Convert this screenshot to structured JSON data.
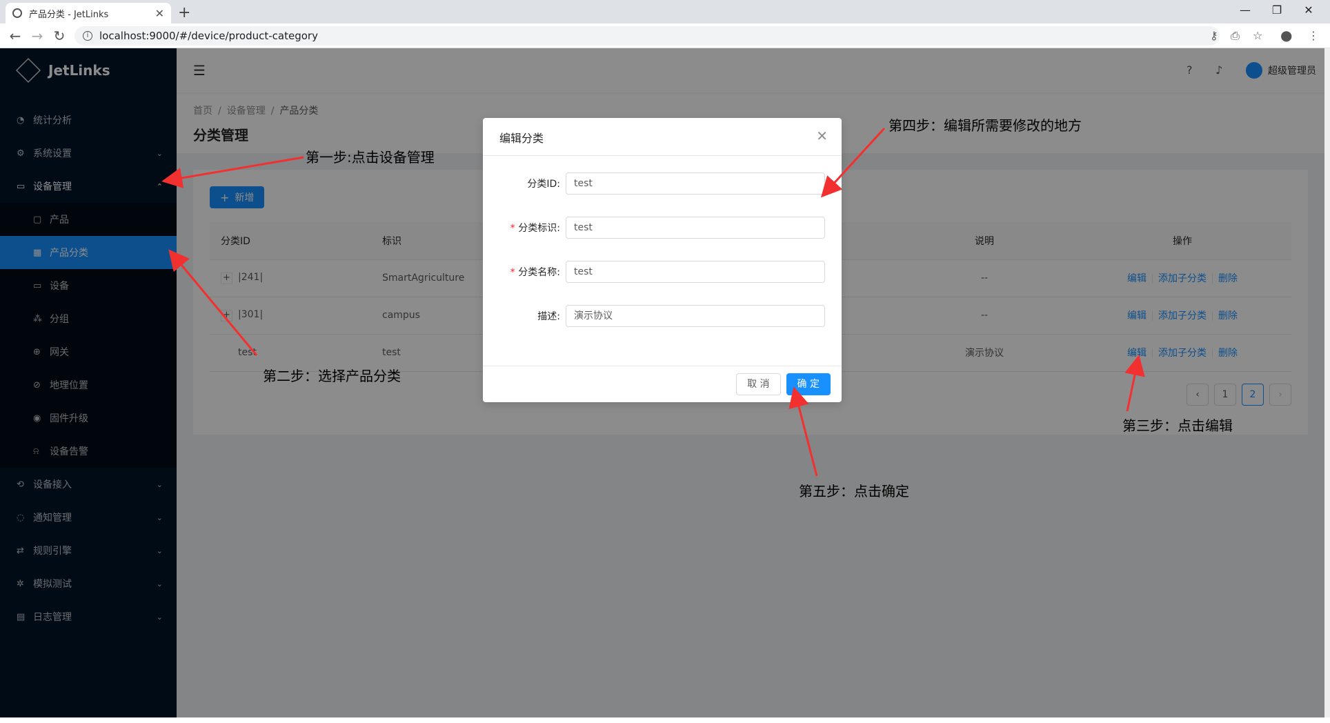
{
  "browser": {
    "tab_title": "产品分类 - JetLinks",
    "tab_close": "✕",
    "new_tab": "+",
    "url": "localhost:9000/#/device/product-category",
    "win_min": "—",
    "win_restore": "❐",
    "win_close": "✕"
  },
  "app": {
    "logo": "JetLinks",
    "user": "超级管理员"
  },
  "sidebar": {
    "items": [
      {
        "label": "统计分析",
        "icon": "dashboard-icon"
      },
      {
        "label": "系统设置",
        "icon": "gear-icon"
      },
      {
        "label": "设备管理",
        "icon": "device-icon"
      },
      {
        "label": "产品",
        "icon": "product-icon"
      },
      {
        "label": "产品分类",
        "icon": "category-icon"
      },
      {
        "label": "设备",
        "icon": "monitor-icon"
      },
      {
        "label": "分组",
        "icon": "cluster-icon"
      },
      {
        "label": "网关",
        "icon": "globe-icon"
      },
      {
        "label": "地理位置",
        "icon": "compass-icon"
      },
      {
        "label": "固件升级",
        "icon": "eye-icon"
      },
      {
        "label": "设备告警",
        "icon": "alarm-icon"
      },
      {
        "label": "设备接入",
        "icon": "login-icon"
      },
      {
        "label": "通知管理",
        "icon": "message-icon"
      },
      {
        "label": "规则引擎",
        "icon": "retweet-icon"
      },
      {
        "label": "模拟测试",
        "icon": "bug-icon"
      },
      {
        "label": "日志管理",
        "icon": "calendar-icon"
      }
    ]
  },
  "page": {
    "breadcrumb": [
      "首页",
      "设备管理",
      "产品分类"
    ],
    "title": "分类管理",
    "add_button": "新增"
  },
  "table": {
    "columns": [
      "分类ID",
      "标识",
      "说明",
      "操作"
    ],
    "rows": [
      {
        "id": "|241|",
        "key": "SmartAgriculture",
        "desc": "--",
        "expand": "+"
      },
      {
        "id": "|301|",
        "key": "campus",
        "desc": "--",
        "expand": "+"
      },
      {
        "id": "test",
        "key": "test",
        "desc": "演示协议",
        "expand": ""
      }
    ],
    "actions": [
      "编辑",
      "添加子分类",
      "删除"
    ]
  },
  "pagination": {
    "prev": "‹",
    "pages": [
      "1",
      "2"
    ],
    "current": "2",
    "next": "›"
  },
  "modal": {
    "title": "编辑分类",
    "close": "✕",
    "fields": [
      {
        "label": "分类ID:",
        "value": "test",
        "required": false
      },
      {
        "label": "分类标识:",
        "value": "test",
        "required": true
      },
      {
        "label": "分类名称:",
        "value": "test",
        "required": true
      },
      {
        "label": "描述:",
        "value": "演示协议",
        "required": false
      }
    ],
    "required_mark": "*",
    "cancel": "取 消",
    "ok": "确 定"
  },
  "annotations": {
    "step1": "第一步:点击设备管理",
    "step2": "第二步：选择产品分类",
    "step3": "第三步：点击编辑",
    "step4": "第四步：编辑所需要修改的地方",
    "step5": "第五步：点击确定"
  },
  "colors": {
    "primary": "#1890ff",
    "sider": "#001529",
    "arrow": "#f23030"
  }
}
